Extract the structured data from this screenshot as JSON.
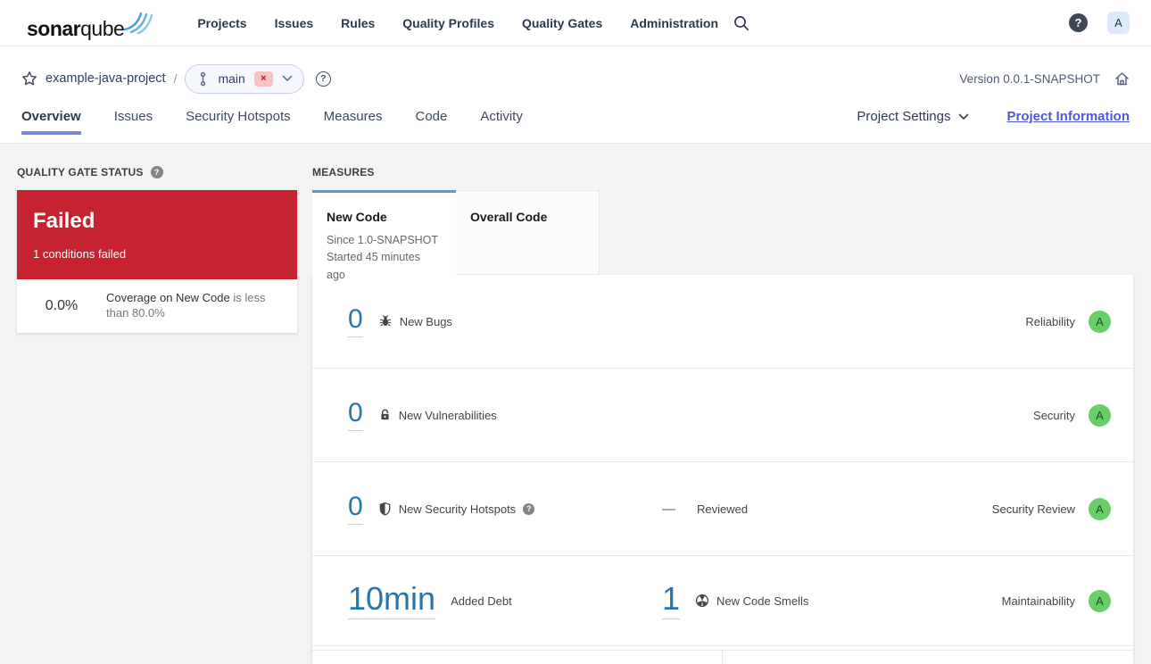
{
  "topbar": {
    "logo_bold": "sonar",
    "logo_light": "qube",
    "nav": [
      "Projects",
      "Issues",
      "Rules",
      "Quality Profiles",
      "Quality Gates",
      "Administration"
    ],
    "help_label": "?",
    "avatar": "A"
  },
  "breadcrumb": {
    "project": "example-java-project",
    "separator": "/",
    "branch": "main",
    "remove_badge": "×",
    "help_label": "?",
    "version": "Version 0.0.1-SNAPSHOT"
  },
  "tabs": {
    "items": [
      "Overview",
      "Issues",
      "Security Hotspots",
      "Measures",
      "Code",
      "Activity"
    ],
    "project_settings": "Project Settings",
    "project_information": "Project Information"
  },
  "quality_gate": {
    "title": "QUALITY GATE STATUS",
    "help_label": "?",
    "status": "Failed",
    "conditions_summary": "1 conditions failed",
    "condition": {
      "value": "0.0%",
      "metric": "Coverage on New Code",
      "comparator": "is less than 80.0%"
    }
  },
  "measures": {
    "title": "MEASURES",
    "tabs": {
      "new_code": {
        "label": "New Code",
        "line1": "Since 1.0-SNAPSHOT",
        "line2": "Started 45 minutes ago"
      },
      "overall_code": {
        "label": "Overall Code"
      }
    },
    "rows": [
      {
        "value": "0",
        "label": "New Bugs",
        "rating_label": "Reliability",
        "rating": "A"
      },
      {
        "value": "0",
        "label": "New Vulnerabilities",
        "rating_label": "Security",
        "rating": "A"
      },
      {
        "value": "0",
        "label": "New Security Hotspots",
        "help_label": "?",
        "dash": "—",
        "extra_label": "Reviewed",
        "rating_label": "Security Review",
        "rating": "A"
      },
      {
        "value": "10min",
        "label": "Added Debt",
        "value2": "1",
        "label2": "New Code Smells",
        "rating_label": "Maintainability",
        "rating": "A"
      }
    ]
  },
  "colors": {
    "accent_blue": "#4b9fd5",
    "link_blue": "#2776a9",
    "failed_red": "#c6222f",
    "rating_a_green": "#68ce68",
    "active_tab_underline": "#7b88d8"
  }
}
